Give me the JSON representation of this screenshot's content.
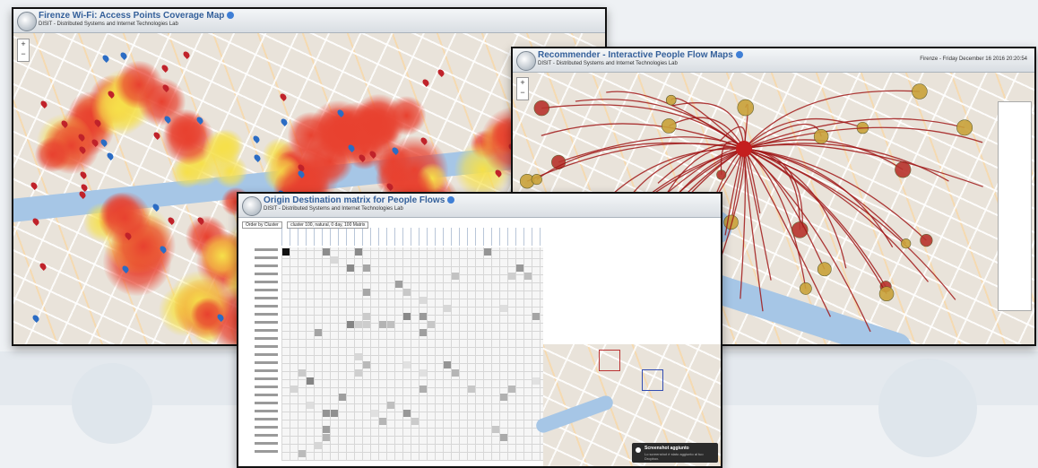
{
  "windows": {
    "wifi": {
      "title": "Firenze Wi-Fi: Access Points Coverage Map",
      "subtitle": "DISIT - Distributed Systems and Internet Technologies Lab"
    },
    "od": {
      "title": "Origin Destination matrix for People Flows",
      "subtitle": "DISIT - Distributed Systems and Internet Technologies Lab",
      "filter_label": "Order by Cluster",
      "filter_info": "cluster 100, natural, 0 day, 100 Matrix"
    },
    "flow": {
      "title": "Recommender - Interactive People Flow Maps",
      "subtitle": "DISIT - Distributed Systems and Internet Technologies Lab",
      "date": "Firenze - Friday December 16 2016 20:20:54"
    },
    "toast": {
      "title": "Screenshot aggiunto",
      "body": "Lo screenshot è stato aggiunto al tuo Dropbox."
    }
  },
  "colors": {
    "header_title": "#335f9a",
    "heat_red": "#e8412f",
    "heat_yellow": "#f6e04a",
    "pin_red": "#c0222a",
    "pin_blue": "#2b6cc4",
    "flow_line": "#a01818",
    "river": "#a6c6e6"
  },
  "icons": [
    "disit-logo-icon",
    "help-icon",
    "map-pin-icon",
    "zoom-in-icon",
    "zoom-out-icon",
    "dropbox-icon"
  ]
}
